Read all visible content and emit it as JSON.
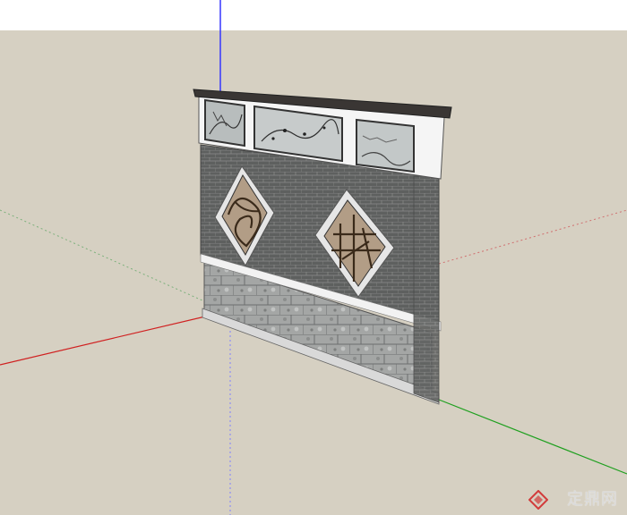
{
  "scene": {
    "background_color": "#ffffff",
    "ground_color": "#d5cfc1",
    "axes": {
      "blue_axis_color": "#3b3bff",
      "red_axis_color": "#d02020",
      "green_axis_color": "#20a020"
    },
    "wall": {
      "brick_color": "#5b5d5c",
      "stone_base_color": "#9a9c9b",
      "cap_color": "#3d3a38",
      "trim_color": "#f4f4f4",
      "window_panels": [
        "landscape-painting",
        "plum-blossom-painting",
        "landscape-painting"
      ],
      "lattice_windows": [
        "lattice-left",
        "lattice-right"
      ]
    }
  },
  "watermark": {
    "text": "定鼎网",
    "logo": "dingding-logo-icon"
  }
}
